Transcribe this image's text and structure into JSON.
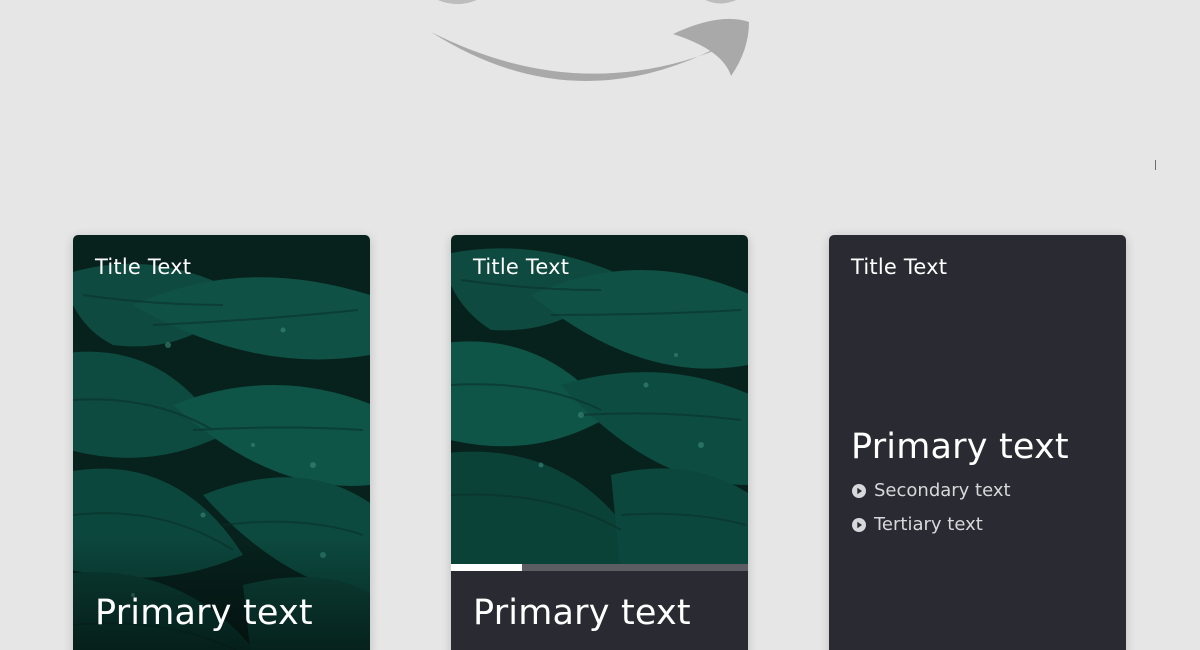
{
  "cards": [
    {
      "title": "Title Text",
      "primary": "Primary text"
    },
    {
      "title": "Title Text",
      "primary": "Primary text",
      "progress_percent": 24
    },
    {
      "title": "Title Text",
      "primary": "Primary text",
      "secondary": "Secondary text",
      "tertiary": "Tertiary text"
    }
  ],
  "colors": {
    "background": "#e6e6e6",
    "card_dark": "#2a2b32",
    "leaf_green": "#0f4a3f",
    "logo_gray": "#a9a9a9"
  },
  "icons": {
    "logo": "amazon-smile-logo",
    "bullet": "play-circle-icon"
  }
}
